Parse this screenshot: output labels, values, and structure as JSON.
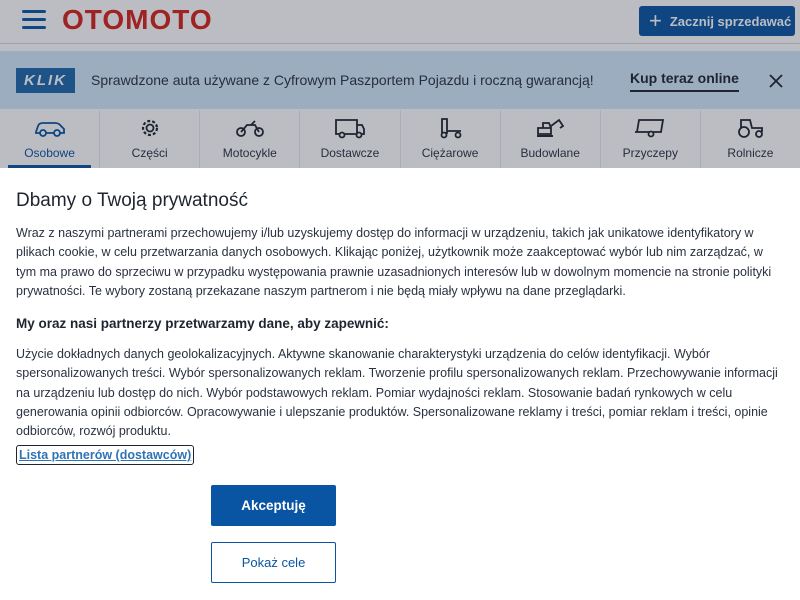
{
  "header": {
    "logo": "OTOMOTO",
    "sell_button": "Zacznij sprzedawać"
  },
  "banner": {
    "badge": "KLIK",
    "text": "Sprawdzone auta używane z Cyfrowym Paszportem Pojazdu i roczną gwarancją!",
    "cta": "Kup teraz online"
  },
  "categories": [
    {
      "label": "Osobowe",
      "icon": "car-icon"
    },
    {
      "label": "Części",
      "icon": "gear-icon"
    },
    {
      "label": "Motocykle",
      "icon": "motorcycle-icon"
    },
    {
      "label": "Dostawcze",
      "icon": "van-icon"
    },
    {
      "label": "Ciężarowe",
      "icon": "truck-icon"
    },
    {
      "label": "Budowlane",
      "icon": "excavator-icon"
    },
    {
      "label": "Przyczepy",
      "icon": "trailer-icon"
    },
    {
      "label": "Rolnicze",
      "icon": "tractor-icon"
    }
  ],
  "consent": {
    "title": "Dbamy o Twoją prywatność",
    "intro": "Wraz z naszymi partnerami przechowujemy i/lub uzyskujemy dostęp do informacji w urządzeniu, takich jak unikatowe identyfikatory w plikach cookie, w celu przetwarzania danych osobowych. Klikając poniżej, użytkownik może zaakceptować wybór lub nim zarządzać, w tym ma prawo do sprzeciwu w przypadku występowania prawnie uzasadnionych interesów lub w dowolnym momencie na stronie polityki prywatności. Te wybory zostaną przekazane naszym partnerom i nie będą miały wpływu na dane przeglądarki.",
    "subtitle": "My oraz nasi partnerzy przetwarzamy dane, aby zapewnić:",
    "purposes": "Użycie dokładnych danych geolokalizacyjnych. Aktywne skanowanie charakterystyki urządzenia do celów identyfikacji. Wybór spersonalizowanych treści. Wybór spersonalizowanych reklam. Tworzenie profilu spersonalizowanych reklam. Przechowywanie informacji na urządzeniu lub dostęp do nich. Wybór podstawowych reklam. Pomiar wydajności reklam. Stosowanie badań rynkowych w celu generowania opinii odbiorców. Opracowywanie i ulepszanie produktów. Spersonalizowane reklamy i treści, pomiar reklam i treści, opinie odbiorców, rozwój produktu.",
    "partners_link": "Lista partnerów (dostawców)",
    "accept_button": "Akceptuję",
    "goals_button": "Pokaż cele"
  },
  "colors": {
    "primary": "#0a55a3",
    "logo_red": "#d6231b",
    "banner_bg": "#d2e9fb"
  }
}
